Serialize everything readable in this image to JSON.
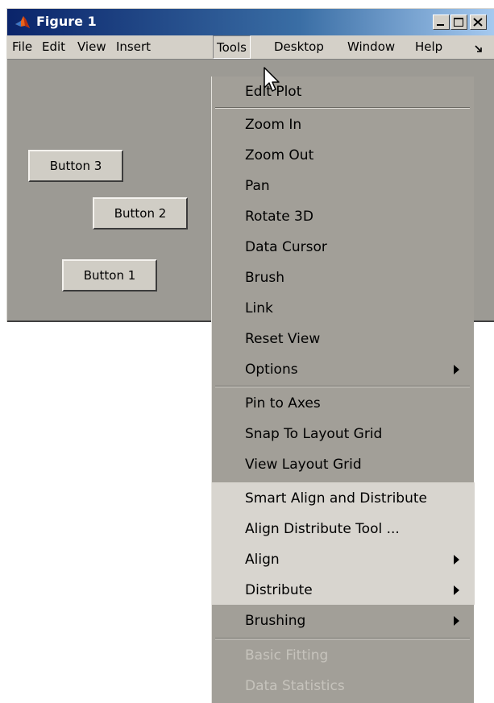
{
  "window": {
    "title": "Figure 1"
  },
  "menubar": {
    "items": [
      {
        "label": "File"
      },
      {
        "label": "Edit"
      },
      {
        "label": "View"
      },
      {
        "label": "Insert"
      },
      {
        "label": "Tools"
      },
      {
        "label": "Desktop"
      },
      {
        "label": "Window"
      },
      {
        "label": "Help"
      }
    ],
    "overflow_icon": "chevron-right-icon"
  },
  "canvas": {
    "buttons": [
      {
        "label": "Button 3"
      },
      {
        "label": "Button 2"
      },
      {
        "label": "Button 1"
      }
    ]
  },
  "tools_menu": {
    "items": [
      {
        "label": "Edit Plot"
      },
      {
        "label": "Zoom In"
      },
      {
        "label": "Zoom Out"
      },
      {
        "label": "Pan"
      },
      {
        "label": "Rotate 3D"
      },
      {
        "label": "Data Cursor"
      },
      {
        "label": "Brush"
      },
      {
        "label": "Link"
      },
      {
        "label": "Reset View"
      },
      {
        "label": "Options",
        "submenu": true
      },
      {
        "label": "Pin to Axes"
      },
      {
        "label": "Snap To Layout Grid"
      },
      {
        "label": "View Layout Grid"
      },
      {
        "label": "Smart Align and Distribute"
      },
      {
        "label": "Align Distribute Tool ..."
      },
      {
        "label": "Align",
        "submenu": true
      },
      {
        "label": "Distribute",
        "submenu": true
      },
      {
        "label": "Brushing",
        "submenu": true
      },
      {
        "label": "Basic Fitting",
        "disabled": true
      },
      {
        "label": "Data Statistics",
        "disabled": true
      }
    ]
  },
  "colors": {
    "titlebar_start": "#0a246a",
    "titlebar_end": "#a6caf0",
    "figure_background": "#9c9a94",
    "menu_background": "#a29f98",
    "menu_highlight_section": "#d8d5cf",
    "disabled_text": "#c6c3bc"
  }
}
